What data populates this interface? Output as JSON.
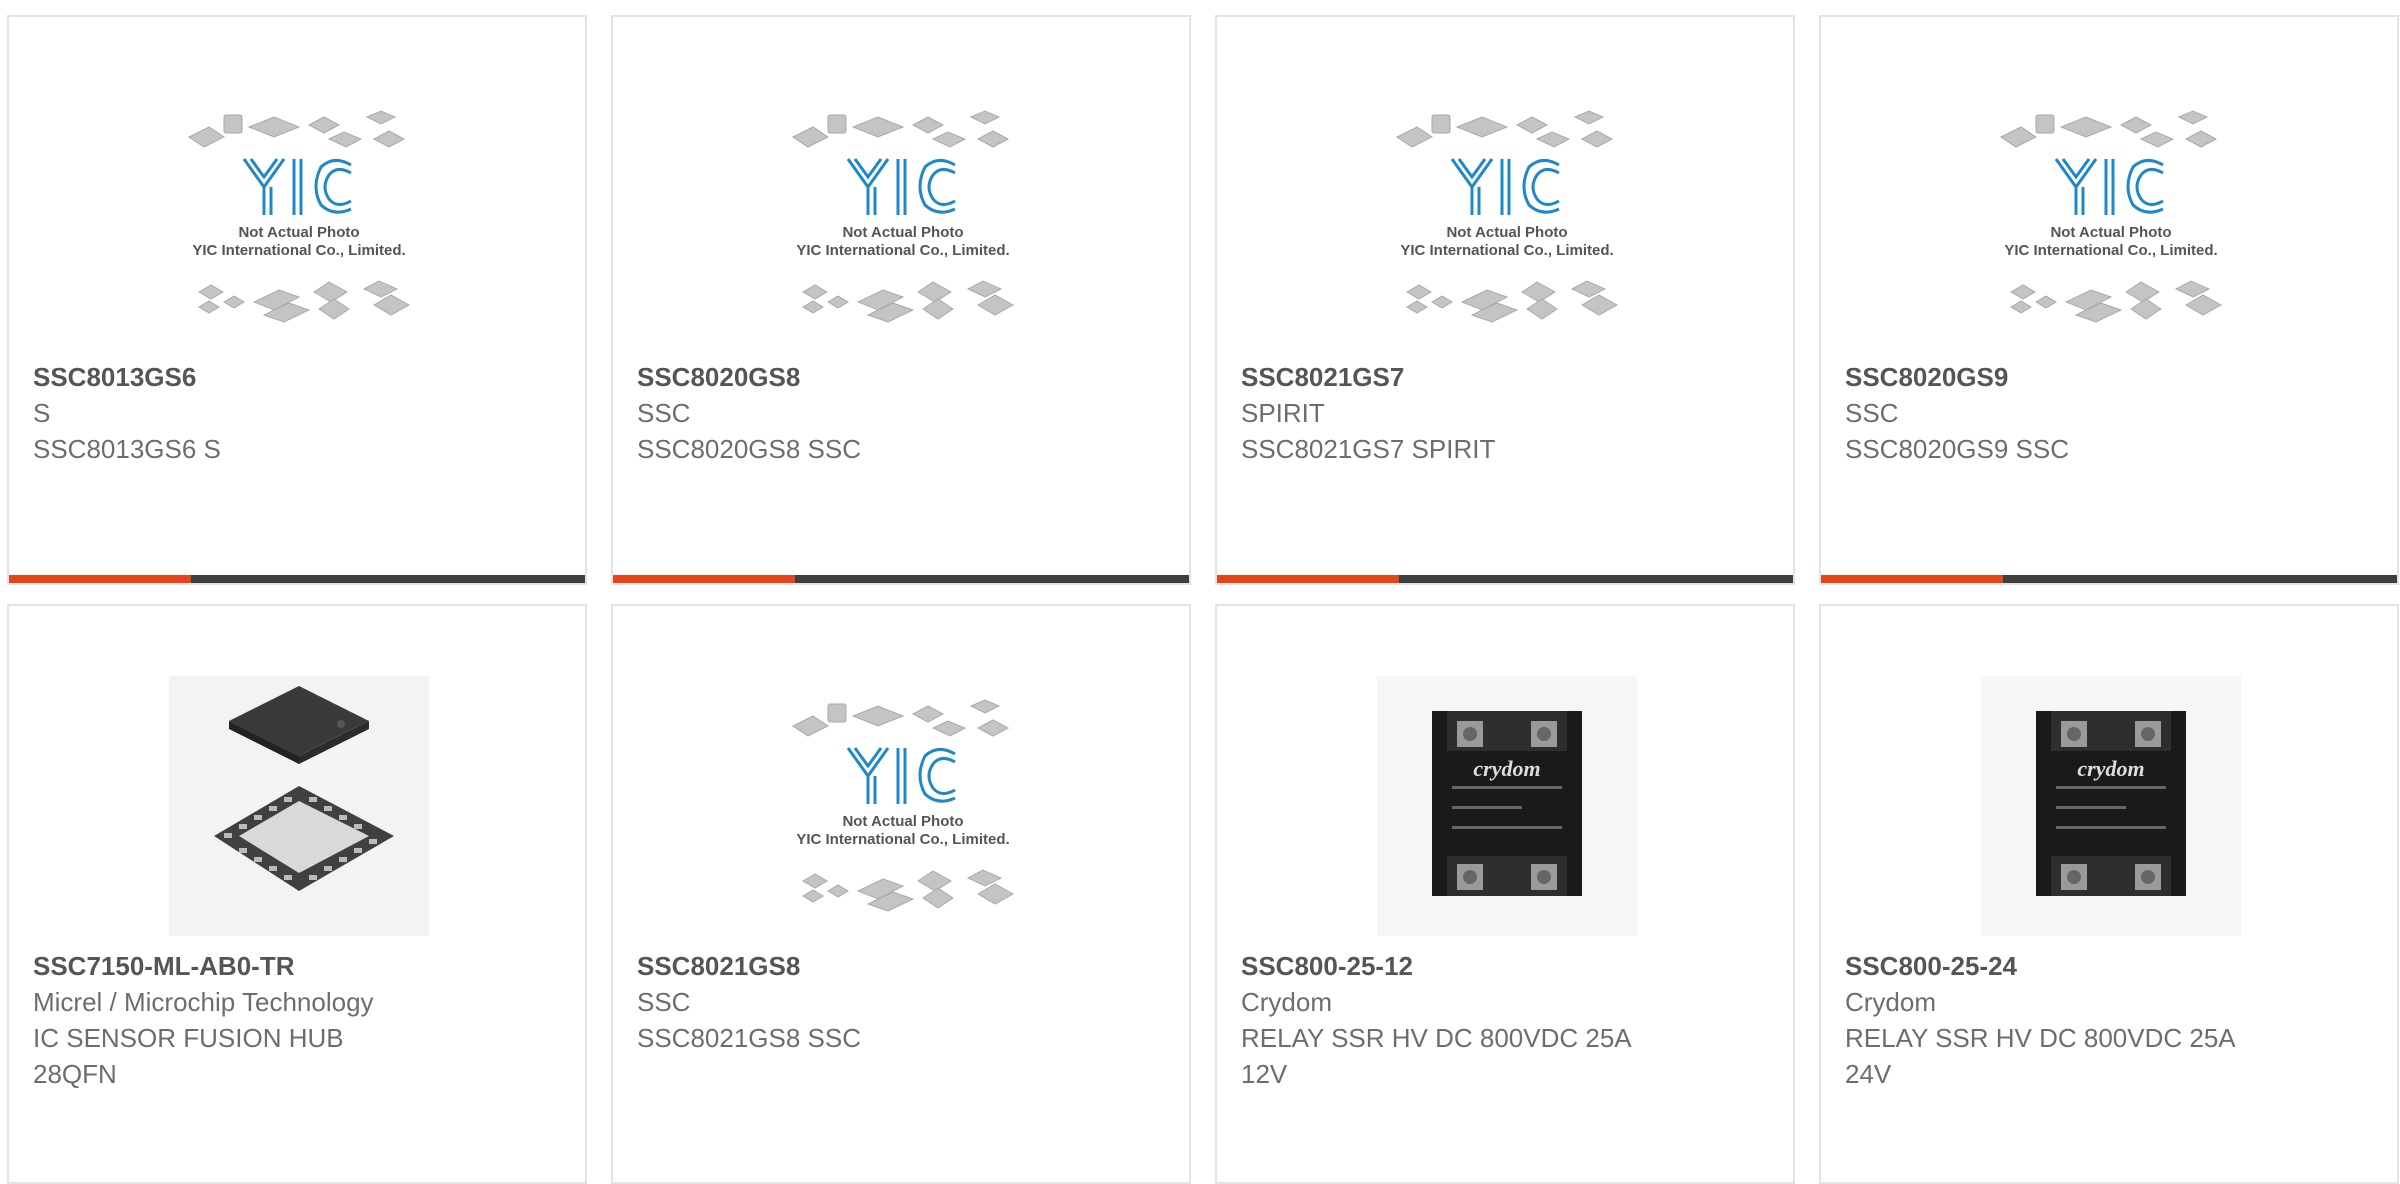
{
  "products": [
    {
      "part_number": "SSC8013GS6",
      "manufacturer": "S",
      "description": "SSC8013GS6 S",
      "image": "placeholder-not-actual-photo",
      "placeholder_line1": "Not Actual Photo",
      "placeholder_line2": "YIC International Co., Limited."
    },
    {
      "part_number": "SSC8020GS8",
      "manufacturer": "SSC",
      "description": "SSC8020GS8 SSC",
      "image": "placeholder-not-actual-photo",
      "placeholder_line1": "Not Actual Photo",
      "placeholder_line2": "YIC International Co., Limited."
    },
    {
      "part_number": "SSC8021GS7",
      "manufacturer": "SPIRIT",
      "description": "SSC8021GS7 SPIRIT",
      "image": "placeholder-not-actual-photo",
      "placeholder_line1": "Not Actual Photo",
      "placeholder_line2": "YIC International Co., Limited."
    },
    {
      "part_number": "SSC8020GS9",
      "manufacturer": "SSC",
      "description": "SSC8020GS9 SSC",
      "image": "placeholder-not-actual-photo",
      "placeholder_line1": "Not Actual Photo",
      "placeholder_line2": "YIC International Co., Limited."
    },
    {
      "part_number": "SSC7150-ML-AB0-TR",
      "manufacturer": "Micrel / Microchip Technology",
      "description": "IC SENSOR FUSION HUB 28QFN",
      "image": "qfn-chip-photo"
    },
    {
      "part_number": "SSC8021GS8",
      "manufacturer": "SSC",
      "description": "SSC8021GS8 SSC",
      "image": "placeholder-not-actual-photo",
      "placeholder_line1": "Not Actual Photo",
      "placeholder_line2": "YIC International Co., Limited."
    },
    {
      "part_number": "SSC800-25-12",
      "manufacturer": "Crydom",
      "description": "RELAY SSR HV DC 800VDC 25A 12V",
      "image": "solid-state-relay-photo",
      "relay_brand": "crydom"
    },
    {
      "part_number": "SSC800-25-24",
      "manufacturer": "Crydom",
      "description": "RELAY SSR HV DC 800VDC 25A 24V",
      "image": "solid-state-relay-photo",
      "relay_brand": "crydom"
    }
  ],
  "colors": {
    "accent": "#e8441c",
    "bar": "#3f3f3f",
    "logo_blue": "#1e88c8",
    "text_bold": "#555555",
    "text": "#6d6d6d",
    "border": "#e3e3e3"
  }
}
